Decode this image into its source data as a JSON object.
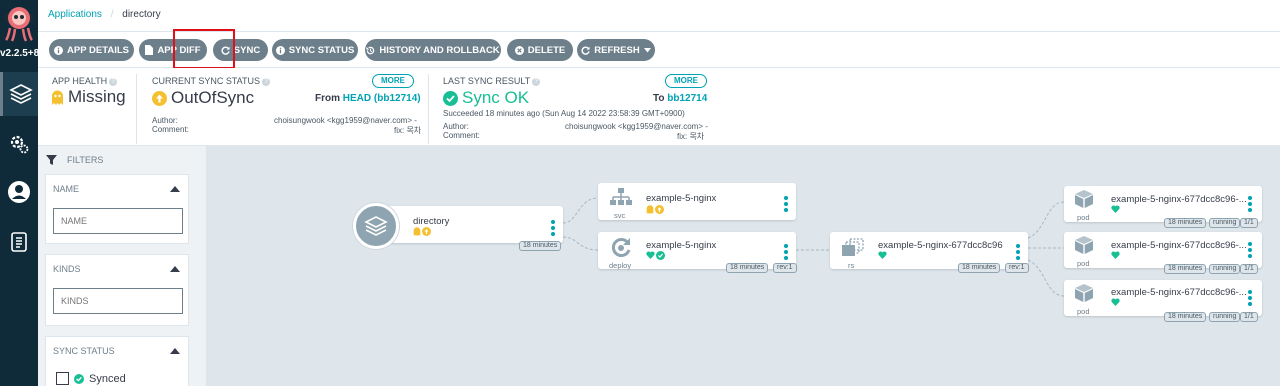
{
  "nav": {
    "version": "v2.2.5+8",
    "items": [
      {
        "icon": "applications-icon",
        "active": true
      },
      {
        "icon": "settings-icon",
        "active": false
      },
      {
        "icon": "user-icon",
        "active": false
      },
      {
        "icon": "docs-icon",
        "active": false
      }
    ]
  },
  "breadcrumb": {
    "root": "Applications",
    "current": "directory"
  },
  "toolbar": {
    "app_details": "APP DETAILS",
    "app_diff": "APP DIFF",
    "sync": "SYNC",
    "sync_status": "SYNC STATUS",
    "history": "HISTORY AND ROLLBACK",
    "delete": "DELETE",
    "refresh": "REFRESH"
  },
  "status": {
    "app_health_label": "APP HEALTH",
    "app_health_value": "Missing",
    "sync_label": "CURRENT SYNC STATUS",
    "sync_value": "OutOfSync",
    "sync_from_prefix": "From",
    "sync_from_ref": "HEAD (bb12714)",
    "more": "MORE",
    "author_label": "Author:",
    "comment_label": "Comment:",
    "author_value": "choisungwook <kgg1959@naver.com> -",
    "comment_value": "fix: 목차",
    "last_sync_label": "LAST SYNC RESULT",
    "last_sync_value": "Sync OK",
    "last_sync_to_prefix": "To",
    "last_sync_to_ref": "bb12714",
    "last_sync_detail": "Succeeded 18 minutes ago (Sun Aug 14 2022 23:58:39 GMT+0900)"
  },
  "filters": {
    "title": "FILTERS",
    "name_title": "NAME",
    "name_placeholder": "NAME",
    "kinds_title": "KINDS",
    "kinds_placeholder": "KINDS",
    "sync_status_title": "SYNC STATUS",
    "synced_label": "Synced"
  },
  "graph": {
    "app": {
      "name": "directory",
      "age": "18 minutes"
    },
    "svc": {
      "name": "example-5-nginx",
      "kind": "svc"
    },
    "deploy": {
      "name": "example-5-nginx",
      "kind": "deploy",
      "age": "18 minutes",
      "rev": "rev:1"
    },
    "rs": {
      "name": "example-5-nginx-677dcc8c96",
      "kind": "rs",
      "age": "18 minutes",
      "rev": "rev:1"
    },
    "pods": [
      {
        "name": "example-5-nginx-677dcc8c96-...",
        "kind": "pod",
        "age": "18 minutes",
        "state": "running",
        "ready": "1/1"
      },
      {
        "name": "example-5-nginx-677dcc8c96-...",
        "kind": "pod",
        "age": "18 minutes",
        "state": "running",
        "ready": "1/1"
      },
      {
        "name": "example-5-nginx-677dcc8c96-...",
        "kind": "pod",
        "age": "18 minutes",
        "state": "running",
        "ready": "1/1"
      }
    ]
  },
  "colors": {
    "accent": "#00a2b3",
    "healthy": "#18be94",
    "warning": "#f4c030",
    "nav_bg": "#0f2b3a",
    "button": "#6d7f8b",
    "highlight": "#e0101a"
  }
}
